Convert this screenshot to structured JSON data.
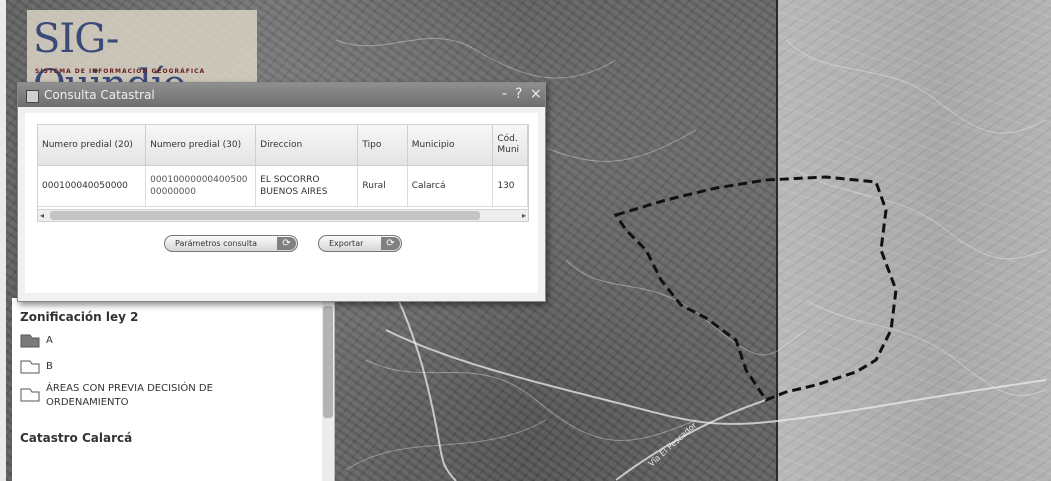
{
  "logo": {
    "title": "SIG-Quindío",
    "subtitle": "SISTEMA DE INFORMACIÓN GEOGRÁFICA"
  },
  "dialog": {
    "title": "Consulta Catastral",
    "controls": {
      "minimize": "-",
      "help": "?",
      "close": "×"
    },
    "columns": [
      "Numero predial (20)",
      "Numero predial (30)",
      "Direccion",
      "Tipo",
      "Municipio",
      "Cód. Muni"
    ],
    "rows": [
      {
        "numero_20": "000100040050000",
        "numero_30": "0001000000040050000000000",
        "direccion": "EL SOCORRO BUENOS AIRES",
        "tipo": "Rural",
        "municipio": "Calarcá",
        "cod_muni": "130"
      }
    ],
    "buttons": {
      "parametros": "Parámetros consulta",
      "exportar": "Exportar"
    }
  },
  "legend": {
    "sections": [
      {
        "title": "Zonificación ley 2",
        "items": [
          "A",
          "B",
          "ÁREAS CON PREVIA DECISIÓN DE ORDENAMIENTO"
        ]
      },
      {
        "title": "Catastro Calarcá",
        "items": []
      }
    ]
  },
  "map": {
    "road_label": "Vía El Pescador"
  }
}
